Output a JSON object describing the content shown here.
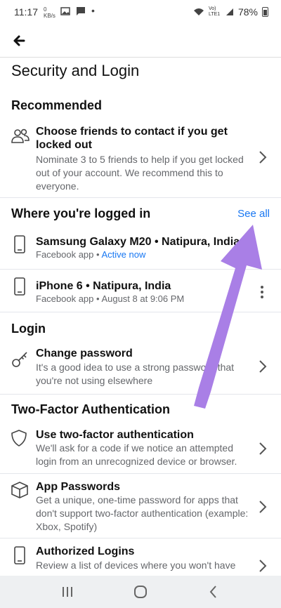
{
  "status": {
    "time": "11:17",
    "net_speed": "0 KB/s",
    "signal_label": "Vo) LTE1",
    "battery": "78%"
  },
  "page": {
    "title": "Security and Login"
  },
  "recommended": {
    "header": "Recommended",
    "item": {
      "title": "Choose friends to contact if you get locked out",
      "description": "Nominate 3 to 5 friends to help if you get locked out of your account. We recommend this to everyone.",
      "icon": "friends-icon"
    }
  },
  "logged_in": {
    "header": "Where you're logged in",
    "see_all": "See all",
    "devices": [
      {
        "name": "Samsung Galaxy M20 • Natipura, India",
        "app": "Facebook app",
        "separator": " • ",
        "status": "Active now",
        "icon": "phone-icon"
      },
      {
        "name": "iPhone 6 • Natipura, India",
        "app": "Facebook app • August 8 at 9:06 PM",
        "icon": "phone-icon"
      }
    ]
  },
  "login": {
    "header": "Login",
    "item": {
      "title": "Change password",
      "description": "It's a good idea to use a strong password that you're not using elsewhere",
      "icon": "key-icon"
    }
  },
  "two_factor": {
    "header": "Two-Factor Authentication",
    "items": [
      {
        "title": "Use two-factor authentication",
        "description": "We'll ask for a code if we notice an attempted login from an unrecognized device or browser.",
        "icon": "shield-icon"
      },
      {
        "title": "App Passwords",
        "description": "Get a unique, one-time password for apps that don't support two-factor authentication (example: Xbox, Spotify)",
        "icon": "box-icon"
      },
      {
        "title": "Authorized Logins",
        "description": "Review a list of devices where you won't have",
        "icon": "phone-icon"
      }
    ]
  },
  "colors": {
    "link": "#1877f2",
    "annotation_arrow": "#a97fe6"
  }
}
